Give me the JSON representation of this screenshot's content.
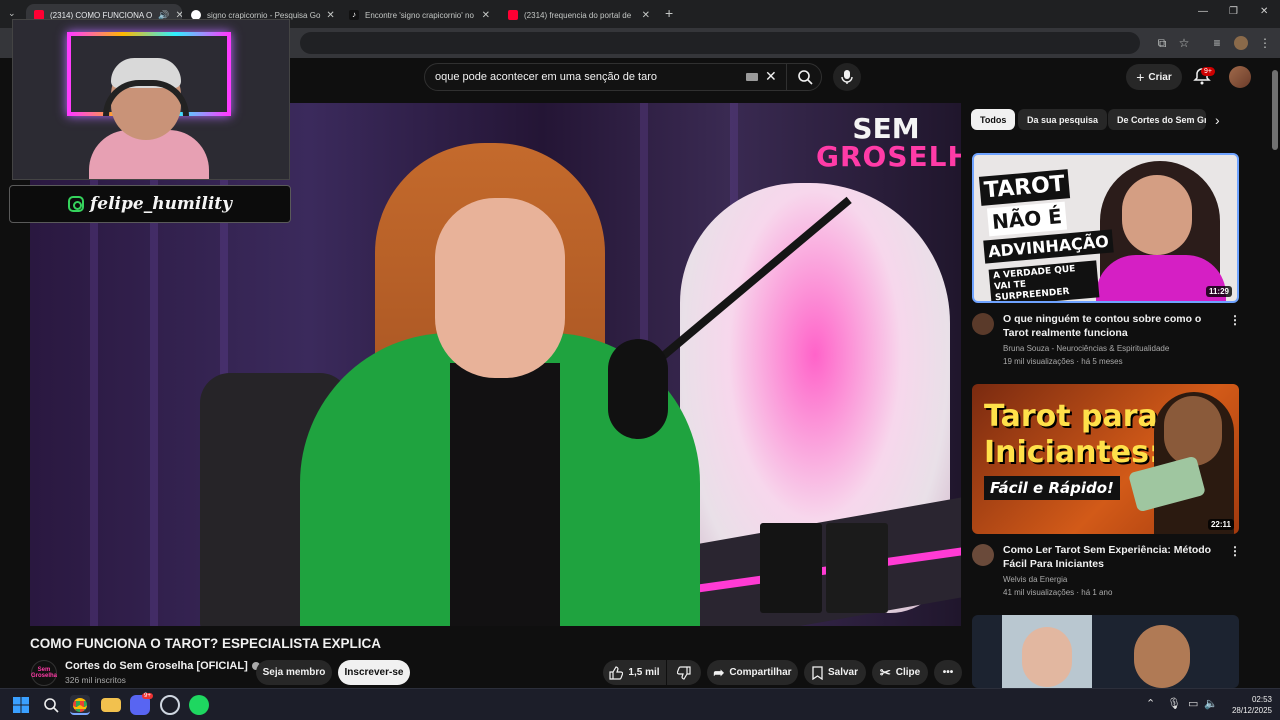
{
  "browser": {
    "tabs": [
      {
        "title": "(2314) COMO FUNCIONA O",
        "favicon_color": "#ff0033",
        "active": true
      },
      {
        "title": "signo crapicornio - Pesquisa Go",
        "favicon_color": "#4285f4",
        "active": false
      },
      {
        "title": "Encontre 'signo crapicornio' no",
        "favicon_color": "#111111",
        "active": false
      },
      {
        "title": "(2314) frequencia do portal de",
        "favicon_color": "#ff0033",
        "active": false
      }
    ],
    "new_tab": "+",
    "window_controls": [
      "—",
      "❐",
      "✕"
    ]
  },
  "youtube": {
    "search_value": "oque pode acontecer em uma senção de taro",
    "create_label": "Criar",
    "notifications_badge": "9+"
  },
  "overlay": {
    "instagram_handle": "felipe_humility"
  },
  "player": {
    "logo_line1": "SEM",
    "logo_line2": "GROSELHA"
  },
  "video": {
    "title": "COMO FUNCIONA O TAROT? ESPECIALISTA EXPLICA",
    "channel_name": "Cortes do Sem Groselha [OFICIAL]",
    "channel_logo_text": "Sem Groselha",
    "subscribers": "326 mil inscritos",
    "join_label": "Seja membro",
    "subscribe_label": "Inscrever-se",
    "likes": "1,5 mil",
    "share_label": "Compartilhar",
    "save_label": "Salvar",
    "clip_label": "Clipe"
  },
  "sidebar": {
    "chips": [
      "Todos",
      "Da sua pesquisa",
      "De Cortes do Sem Gr"
    ],
    "recommendations": [
      {
        "title": "O que ninguém te contou sobre como o Tarot realmente funciona",
        "channel": "Bruna Souza - Neurociências & Espiritualidade",
        "stats": "19 mil visualizações · há 5 meses",
        "duration": "11:29",
        "thumb_lines": [
          "TAROT",
          "NÃO É",
          "ADVINHAÇÃO",
          "A VERDADE QUE VAI TE SURPREENDER"
        ]
      },
      {
        "title": "Como Ler Tarot Sem Experiência: Método Fácil Para Iniciantes",
        "channel": "Welvis da Energia",
        "stats": "41 mil visualizações · há 1 ano",
        "duration": "22:11",
        "thumb_lines": [
          "Tarot para",
          "Iniciantes:",
          "Fácil e Rápido!"
        ]
      }
    ]
  },
  "taskbar": {
    "time": "02:53",
    "date": "28/12/2025",
    "discord_badge": "9+"
  },
  "colors": {
    "yt_bg": "#0f0f0f",
    "accent_red": "#ff0033",
    "neon_pink": "#ff3ba7",
    "green_blazer": "#1fa33f"
  }
}
